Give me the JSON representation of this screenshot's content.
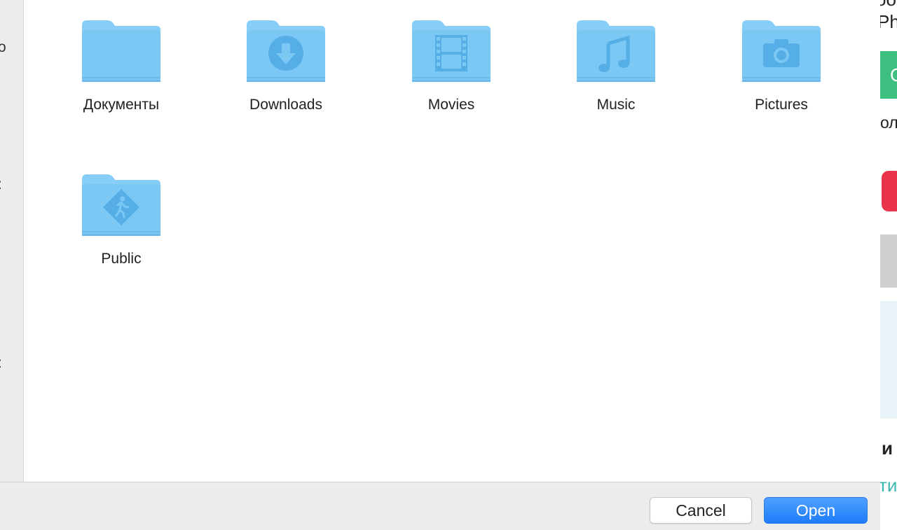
{
  "sidebar": {
    "fragments": [
      "o",
      ":",
      ":"
    ]
  },
  "folders": [
    {
      "name": "Документы",
      "icon": "folder-icon"
    },
    {
      "name": "Downloads",
      "icon": "download-folder-icon"
    },
    {
      "name": "Movies",
      "icon": "movies-folder-icon"
    },
    {
      "name": "Music",
      "icon": "music-folder-icon"
    },
    {
      "name": "Pictures",
      "icon": "pictures-folder-icon"
    },
    {
      "name": "Public",
      "icon": "public-folder-icon"
    }
  ],
  "buttons": {
    "cancel": "Cancel",
    "open": "Open"
  },
  "background_window": {
    "fragments": [
      "oo",
      "Pho",
      "С",
      "ол",
      "и",
      "ти"
    ]
  },
  "colors": {
    "folder": "#7cc8f5",
    "folder_glyph": "#55aee6",
    "open_button": "#1f7dfa",
    "background_green": "#3fbf7f",
    "background_red": "#e8334a"
  }
}
